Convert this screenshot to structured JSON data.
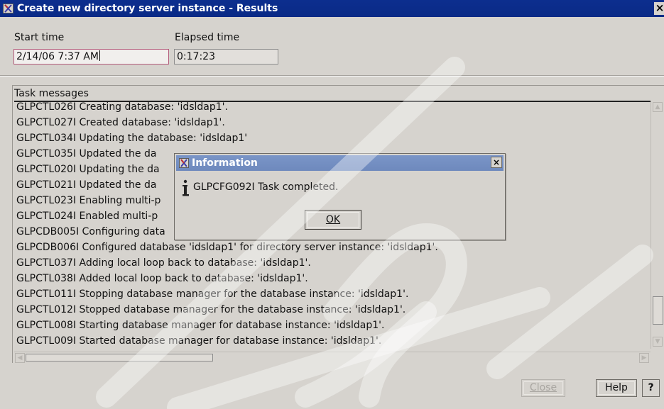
{
  "window": {
    "title": "Create new directory server instance - Results",
    "close_glyph": "×"
  },
  "fields": {
    "start_time_label": "Start time",
    "start_time_value": "2/14/06 7:37 AM",
    "elapsed_time_label": "Elapsed time",
    "elapsed_time_value": "0:17:23"
  },
  "task_messages": {
    "header": "Task messages",
    "lines": [
      "GLPCTL026I Creating database: 'idsldap1'.",
      "GLPCTL027I Created database: 'idsldap1'.",
      "GLPCTL034I Updating the database: 'idsldap1'",
      "GLPCTL035I Updated the da",
      "GLPCTL020I Updating the da",
      "GLPCTL021I Updated the da",
      "GLPCTL023I Enabling multi-p",
      "GLPCTL024I Enabled multi-p",
      "GLPCDB005I Configuring data",
      "GLPCDB006I Configured database 'idsldap1' for directory server instance: 'idsldap1'.",
      "GLPCTL037I Adding local loop back to database: 'idsldap1'.",
      "GLPCTL038I Added local loop back to database: 'idsldap1'.",
      "GLPCTL011I Stopping database manager for the database instance: 'idsldap1'.",
      "GLPCTL012I Stopped database manager for the database instance: 'idsldap1'.",
      "GLPCTL008I Starting database manager for database instance: 'idsldap1'.",
      "GLPCTL009I Started database manager for database instance: 'idsldap1'."
    ]
  },
  "buttons": {
    "close_label": "Close",
    "help_label": "Help",
    "question_label": "?"
  },
  "dialog": {
    "title": "Information",
    "message": "GLPCFG092I Task completed.",
    "ok_label": "OK",
    "close_glyph": "×"
  },
  "icons": {
    "app": "x-window-icon",
    "info": "information-icon"
  },
  "colors": {
    "titlebar": "#0c2e8e",
    "dialog_titlebar": "#7a95c7",
    "window_bg": "#d6d3ce"
  }
}
